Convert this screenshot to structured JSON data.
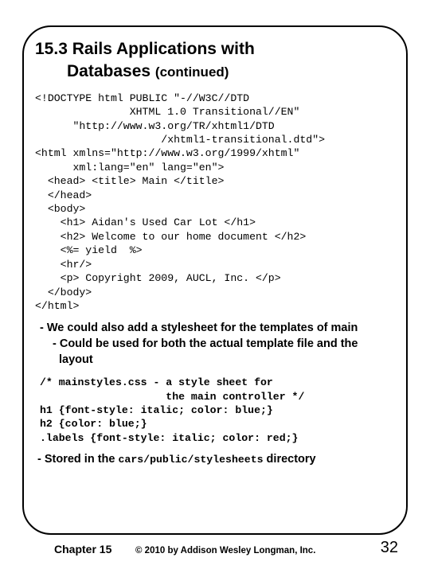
{
  "heading": {
    "number": "15.3",
    "title_line1": "Rails Applications with",
    "title_line2": "Databases",
    "continued": "(continued)"
  },
  "code_block": "<!DOCTYPE html PUBLIC \"-//W3C//DTD\n               XHTML 1.0 Transitional//EN\"\n      \"http://www.w3.org/TR/xhtml1/DTD\n                    /xhtml1-transitional.dtd\">\n<html xmlns=\"http://www.w3.org/1999/xhtml\"\n      xml:lang=\"en\" lang=\"en\">\n  <head> <title> Main </title>\n  </head>\n  <body>\n    <h1> Aidan's Used Car Lot </h1>\n    <h2> Welcome to our home document </h2>\n    <%= yield  %>\n    <hr/>\n    <p> Copyright 2009, AUCL, Inc. </p>\n  </body>\n</html>",
  "bullets": {
    "b1": "- We could also add a stylesheet for the templates of main",
    "b2": "- Could be used for both the actual template file and the layout"
  },
  "css_block": "/* mainstyles.css - a style sheet for\n                    the main controller */\nh1 {font-style: italic; color: blue;}\nh2 {color: blue;}\n.labels {font-style: italic; color: red;}",
  "stored": {
    "prefix": "- Stored in the ",
    "path": "cars/public/stylesheets",
    "suffix": " directory"
  },
  "footer": {
    "chapter": "Chapter 15",
    "copyright": "© 2010 by Addison Wesley Longman, Inc.",
    "page": "32"
  }
}
